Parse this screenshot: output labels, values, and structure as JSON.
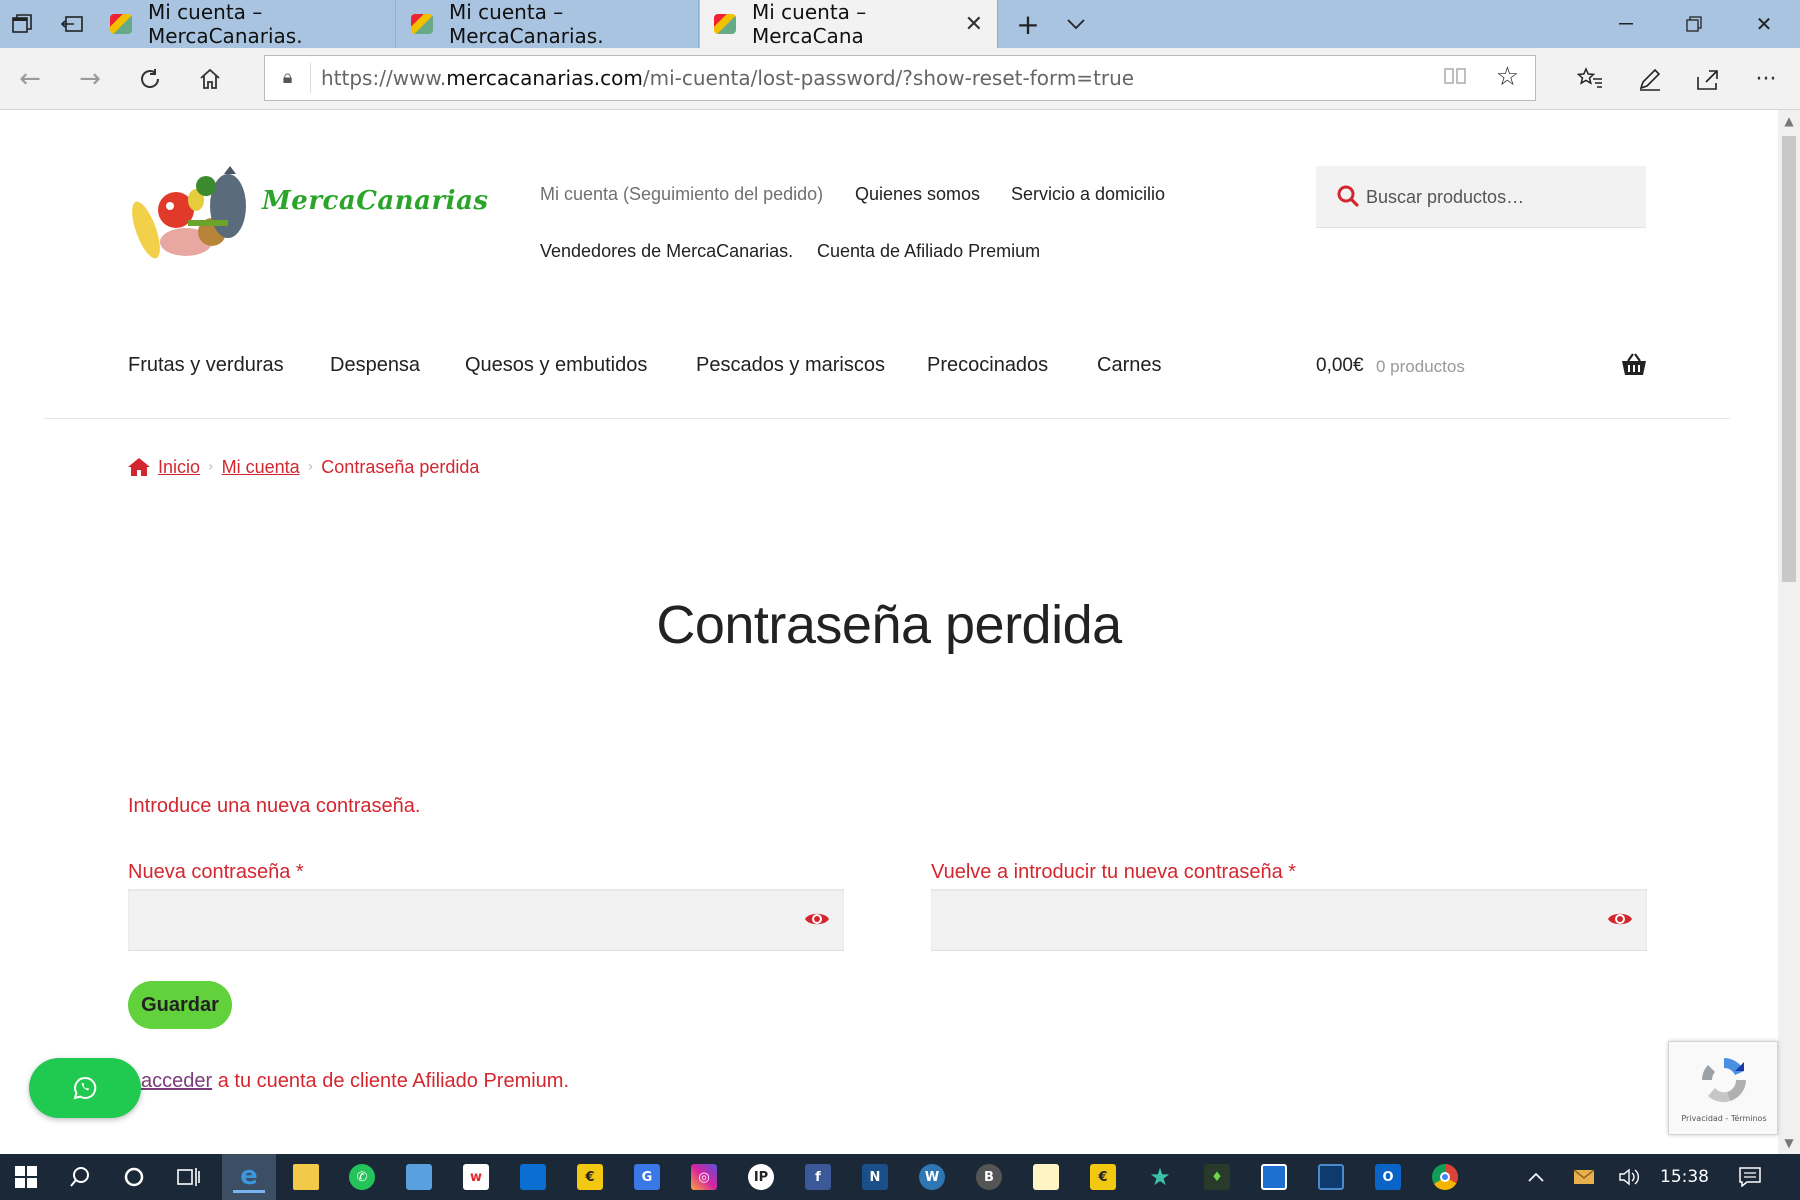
{
  "browser": {
    "tabs": [
      {
        "title": "Mi cuenta – MercaCanarias."
      },
      {
        "title": "Mi cuenta – MercaCanarias."
      },
      {
        "title": "Mi cuenta – MercaCana"
      }
    ],
    "url_prefix": "https://www.",
    "url_domain": "mercacanarias.com",
    "url_path": "/mi-cuenta/lost-password/?show-reset-form=true",
    "icons": [
      "tab-preview-icon",
      "set-aside-icon",
      "new-tab-icon",
      "tab-list-icon",
      "minimize-icon",
      "restore-icon",
      "close-window-icon",
      "back-icon",
      "forward-icon",
      "refresh-icon",
      "home-icon",
      "lock-icon",
      "reading-view-icon",
      "favorite-star-icon",
      "favorites-hub-icon",
      "pen-icon",
      "share-icon",
      "more-icon"
    ]
  },
  "site": {
    "logo_text": "MercaCanarias",
    "top_nav": [
      "Mi cuenta (Seguimiento del pedido)",
      "Quienes somos",
      "Servicio a domicilio",
      "Vendedores de MercaCanarias.",
      "Cuenta de Afiliado Premium"
    ],
    "search_placeholder": "Buscar productos…",
    "categories": [
      "Frutas y verduras",
      "Despensa",
      "Quesos y embutidos",
      "Pescados y mariscos",
      "Precocinados",
      "Carnes"
    ],
    "cart_total": "0,00€",
    "cart_count": "0 productos",
    "accent_color": "#d4262e",
    "button_color": "#62d23c"
  },
  "breadcrumb": {
    "home": "Inicio",
    "account": "Mi cuenta",
    "current": "Contraseña perdida"
  },
  "content": {
    "title": "Contraseña perdida",
    "intro": "Introduce una nueva contraseña.",
    "new_password_label": "Nueva contraseña",
    "confirm_password_label": "Vuelve a introducir tu nueva contraseña",
    "required_mark": "*",
    "save_button": "Guardar",
    "access_link": "acceder",
    "access_suffix": " a tu cuenta de cliente Afiliado Premium."
  },
  "recaptcha_text": "Privacidad - Términos",
  "taskbar": {
    "time": "15:38",
    "apps": [
      "start",
      "search",
      "cortana",
      "task-view",
      "edge",
      "file-explorer",
      "whatsapp",
      "photos",
      "wallapop",
      "store",
      "eurocoin",
      "translate",
      "instagram",
      "ip",
      "facebook",
      "app-n",
      "wordpress",
      "b-app",
      "notes",
      "eurocoin2",
      "star-app",
      "parrot",
      "window-app",
      "dark-app",
      "outlook",
      "chrome"
    ]
  }
}
